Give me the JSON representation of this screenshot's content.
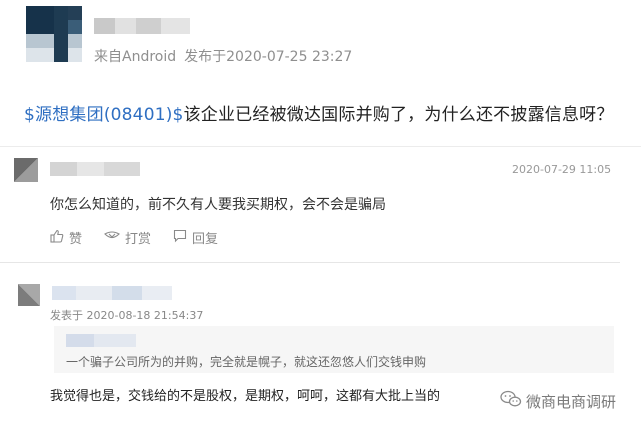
{
  "post": {
    "meta_source": "来自Android",
    "meta_published": "发布于2020-07-25 23:27",
    "stock_tag": "$源想集团(08401)$",
    "body": "该企业已经被微达国际并购了，为什么还不披露信息呀？"
  },
  "comment_1": {
    "timestamp": "2020-07-29 11:05",
    "text": "你怎么知道的，前不久有人要我买期权，会不会是骗局",
    "actions": {
      "like_label": "赞",
      "reward_label": "打赏",
      "reply_label": "回复",
      "like_icon": "thumbs-up-icon",
      "reward_icon": "reward-icon",
      "reply_icon": "comment-icon"
    }
  },
  "comment_2": {
    "timestamp": "发表于 2020-08-18 21:54:37",
    "quote_text": "一个骗子公司所为的并购，完全就是幌子，就这还忽悠人们交钱申购",
    "text": "我觉得也是，交钱给的不是股权，是期权，呵呵，这都有大批上当的"
  },
  "watermark": {
    "text": "微商电商调研",
    "icon": "wechat-icon"
  },
  "colors": {
    "link": "#2f6fc2",
    "meta": "#8f8f8f",
    "body_text": "#222222",
    "quote_bg": "#f6f6f6"
  }
}
